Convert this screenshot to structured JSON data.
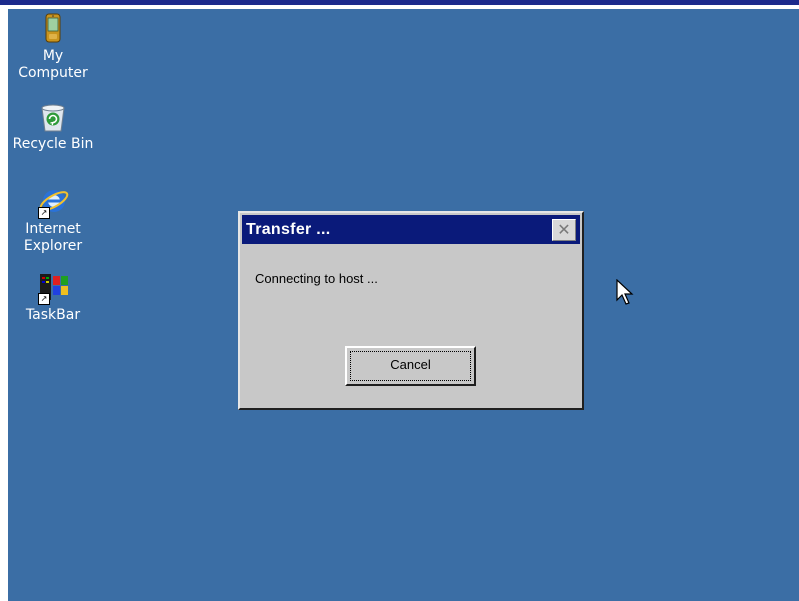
{
  "desktop": {
    "background": "#3b6ea5",
    "icons": [
      {
        "label": "My\nComputer",
        "icon": "handheld-computer-icon",
        "shortcut": false
      },
      {
        "label": "Recycle Bin",
        "icon": "recycle-bin-icon",
        "shortcut": false
      },
      {
        "label": "Internet\nExplorer",
        "icon": "internet-explorer-icon",
        "shortcut": true
      },
      {
        "label": "TaskBar",
        "icon": "taskbar-icon",
        "shortcut": true
      }
    ]
  },
  "dialog": {
    "title": "Transfer ...",
    "close_glyph": "✕",
    "message": "Connecting to host ...",
    "cancel_label": "Cancel",
    "titlebar_color": "#0a1a7a",
    "body_color": "#c8c8c8"
  },
  "cursor": {
    "icon": "arrow-cursor-icon"
  }
}
